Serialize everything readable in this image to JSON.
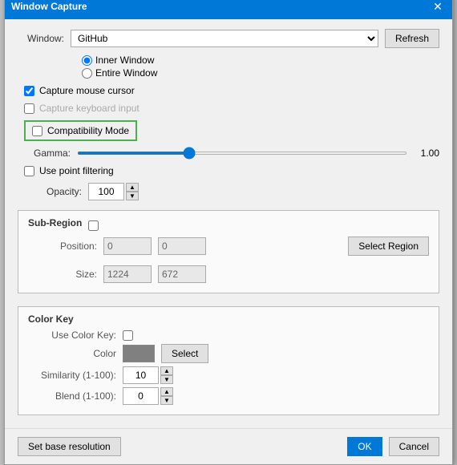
{
  "dialog": {
    "title": "Window Capture",
    "close_label": "✕"
  },
  "window_row": {
    "label": "Window:",
    "value": "GitHub",
    "refresh_label": "Refresh"
  },
  "capture_mode": {
    "inner_window_label": "Inner Window",
    "entire_window_label": "Entire Window"
  },
  "checkboxes": {
    "capture_mouse_label": "Capture mouse cursor",
    "capture_keys_label": "Capture keyboard input",
    "compatibility_label": "Compatibility Mode"
  },
  "gamma": {
    "label": "Gamma:",
    "value": "1.00",
    "min": 0,
    "max": 3,
    "current": 1
  },
  "point_filtering": {
    "label": "Use point filtering"
  },
  "opacity": {
    "label": "Opacity:",
    "value": "100"
  },
  "sub_region": {
    "title": "Sub-Region",
    "checkbox_label": "Sub-Region",
    "position_label": "Position:",
    "x_value": "0",
    "y_value": "0",
    "size_label": "Size:",
    "width_value": "1224",
    "height_value": "672",
    "select_region_label": "Select Region"
  },
  "color_key": {
    "title": "Color Key",
    "use_label": "Use Color Key:",
    "color_label": "Color",
    "select_label": "Select",
    "similarity_label": "Similarity (1-100):",
    "similarity_value": "10",
    "blend_label": "Blend (1-100):",
    "blend_value": "0"
  },
  "footer": {
    "set_base_label": "Set base resolution",
    "ok_label": "OK",
    "cancel_label": "Cancel"
  }
}
